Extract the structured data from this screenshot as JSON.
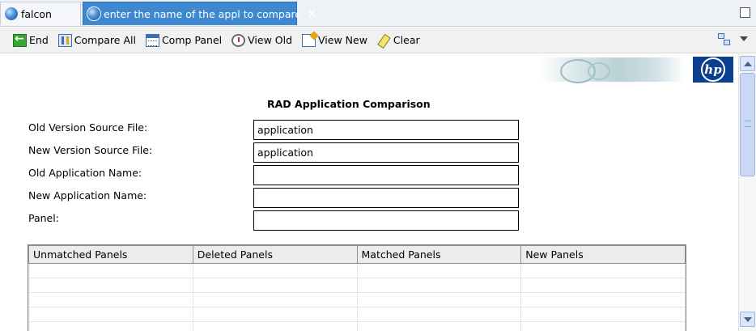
{
  "tabs": [
    {
      "label": "falcon",
      "active": false,
      "icon": "globe-icon"
    },
    {
      "label": "enter the name of the appl to compare",
      "active": true,
      "icon": "globe-icon",
      "close_symbol": "✕"
    }
  ],
  "toolbar": {
    "end_label": "End",
    "compare_all_label": "Compare All",
    "comp_panel_label": "Comp Panel",
    "view_old_label": "View Old",
    "view_new_label": "View New",
    "clear_label": "Clear"
  },
  "logo": {
    "brand_text": "hp"
  },
  "page": {
    "title": "RAD Application Comparison"
  },
  "form": {
    "old_source_label": "Old Version Source File:",
    "old_source_value": "application",
    "new_source_label": "New Version Source File:",
    "new_source_value": "application",
    "old_app_label": "Old Application Name:",
    "old_app_value": "",
    "new_app_label": "New Application Name:",
    "new_app_value": "",
    "panel_label": "Panel:",
    "panel_value": ""
  },
  "panels_table": {
    "columns": [
      "Unmatched Panels",
      "Deleted Panels",
      "Matched Panels",
      "New Panels"
    ],
    "rows": []
  },
  "colors": {
    "active_tab": "#3d88ce",
    "hp_blue": "#0a3e8f",
    "toolbar_bg": "#f1f1f1"
  }
}
